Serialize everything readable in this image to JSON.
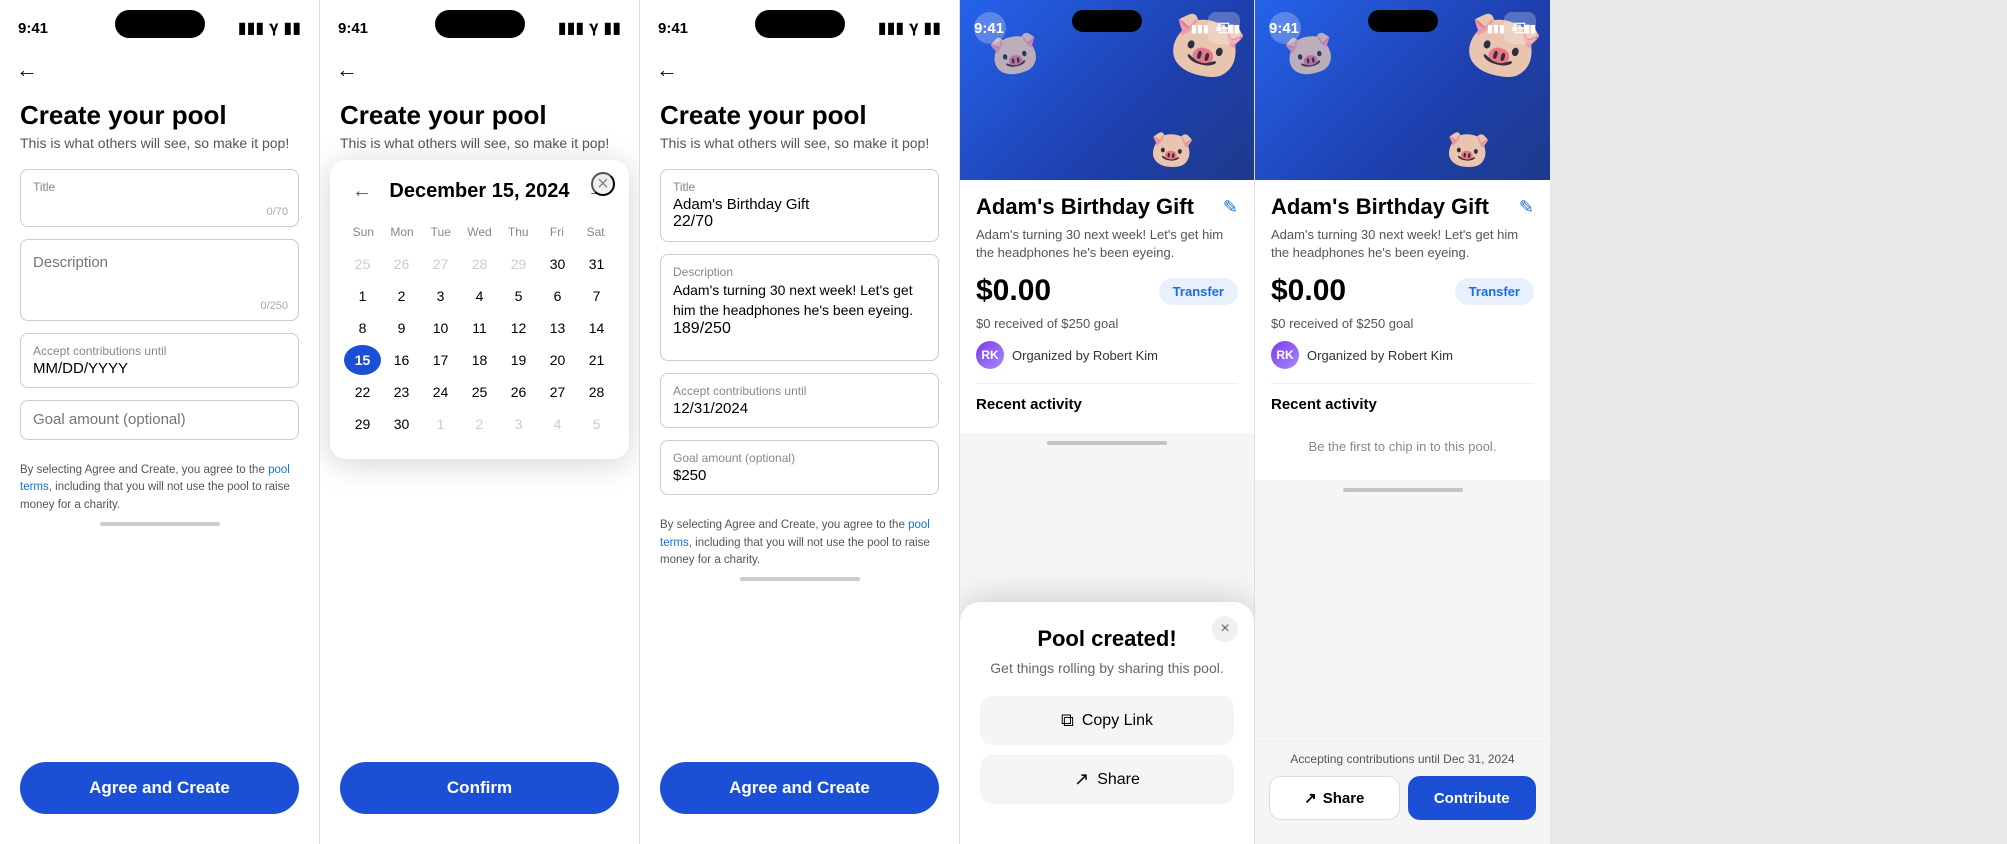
{
  "screens": [
    {
      "id": "screen1",
      "status_time": "9:41",
      "title": "Create your pool",
      "subtitle": "This is what others will see, so make it pop!",
      "fields": {
        "title_label": "Title",
        "title_placeholder": "",
        "title_charcount": "0/70",
        "description_label": "Description",
        "description_placeholder": "Description",
        "description_charcount": "0/250",
        "date_label": "Accept contributions until",
        "date_placeholder": "MM/DD/YYYY",
        "goal_label": "Goal amount (optional)",
        "goal_placeholder": "Goal amount (optional)"
      },
      "terms": "By selecting Agree and Create, you agree to the ",
      "terms_link": "pool terms",
      "terms_end": ", including that you will not use the pool to raise money for a charity.",
      "button_label": "Agree and Create"
    },
    {
      "id": "screen2",
      "status_time": "9:41",
      "title": "Create your pool",
      "subtitle": "This is what others will see, so make it pop!",
      "calendar": {
        "month_year": "December 15, 2024",
        "day_labels": [
          "Sun",
          "Mon",
          "Tue",
          "Wed",
          "Thu",
          "Fri",
          "Sat"
        ],
        "weeks": [
          [
            {
              "day": "25",
              "other": true
            },
            {
              "day": "26",
              "other": true
            },
            {
              "day": "27",
              "other": true
            },
            {
              "day": "28",
              "other": true
            },
            {
              "day": "29",
              "other": true
            },
            {
              "day": "30",
              "other": false
            },
            {
              "day": "31",
              "other": false
            }
          ],
          [
            {
              "day": "1",
              "other": false
            },
            {
              "day": "2",
              "other": false
            },
            {
              "day": "3",
              "other": false
            },
            {
              "day": "4",
              "other": false
            },
            {
              "day": "5",
              "other": false
            },
            {
              "day": "6",
              "other": false
            },
            {
              "day": "7",
              "other": false
            }
          ],
          [
            {
              "day": "8",
              "other": false
            },
            {
              "day": "9",
              "other": false
            },
            {
              "day": "10",
              "other": false
            },
            {
              "day": "11",
              "other": false
            },
            {
              "day": "12",
              "other": false
            },
            {
              "day": "13",
              "other": false
            },
            {
              "day": "14",
              "other": false
            }
          ],
          [
            {
              "day": "15",
              "other": false,
              "selected": true
            },
            {
              "day": "16",
              "other": false
            },
            {
              "day": "17",
              "other": false
            },
            {
              "day": "18",
              "other": false
            },
            {
              "day": "19",
              "other": false
            },
            {
              "day": "20",
              "other": false
            },
            {
              "day": "21",
              "other": false
            }
          ],
          [
            {
              "day": "22",
              "other": false
            },
            {
              "day": "23",
              "other": false
            },
            {
              "day": "24",
              "other": false
            },
            {
              "day": "25",
              "other": false
            },
            {
              "day": "26",
              "other": false
            },
            {
              "day": "27",
              "other": false
            },
            {
              "day": "28",
              "other": false
            }
          ],
          [
            {
              "day": "29",
              "other": false
            },
            {
              "day": "30",
              "other": false
            },
            {
              "day": "1",
              "other": true
            },
            {
              "day": "2",
              "other": true
            },
            {
              "day": "3",
              "other": true
            },
            {
              "day": "4",
              "other": true
            },
            {
              "day": "5",
              "other": true
            }
          ]
        ]
      },
      "button_label": "Confirm"
    },
    {
      "id": "screen3",
      "status_time": "9:41",
      "title": "Create your pool",
      "subtitle": "This is what others will see, so make it pop!",
      "fields": {
        "title_label": "Title",
        "title_value": "Adam's Birthday Gift",
        "title_charcount": "22/70",
        "description_label": "Description",
        "description_value": "Adam's turning 30 next week! Let's get him the headphones he's been eyeing.",
        "description_charcount": "189/250",
        "date_label": "Accept contributions until",
        "date_value": "12/31/2024",
        "goal_label": "Goal amount (optional)",
        "goal_value": "$250"
      },
      "terms": "By selecting Agree and Create, you agree to the ",
      "terms_link": "pool terms",
      "terms_end": ", including that you will not use the pool to raise money for a charity.",
      "button_label": "Agree and Create"
    },
    {
      "id": "screen4",
      "status_time": "9:41",
      "card_title": "Adam's Birthday Gift",
      "card_desc": "Adam's turning 30 next week! Let's get him the headphones he's been eyeing.",
      "amount": "$0.00",
      "transfer_btn": "Transfer",
      "goal_text": "$0 received of $250 goal",
      "organizer": "Organized by Robert Kim",
      "recent_activity": "Recent activity",
      "activity_empty": "Be the first to chip in to this pool.",
      "modal": {
        "title": "Pool created!",
        "subtitle": "Get things rolling by sharing this pool.",
        "copy_link": "Copy Link",
        "share": "Share"
      }
    },
    {
      "id": "screen5",
      "status_time": "9:41",
      "card_title": "Adam's Birthday Gift",
      "card_desc": "Adam's turning 30 next week! Let's get him the headphones he's been eyeing.",
      "amount": "$0.00",
      "transfer_btn": "Transfer",
      "goal_text": "$0 received of $250 goal",
      "organizer": "Organized by Robert Kim",
      "recent_activity": "Recent activity",
      "activity_empty": "Be the first to chip in to this pool.",
      "accepting_text": "Accepting contributions until Dec 31, 2024",
      "share_btn": "Share",
      "contribute_btn": "Contribute"
    }
  ],
  "icons": {
    "back_arrow": "←",
    "close": "×",
    "cal_prev": "←",
    "cal_next": "→",
    "edit": "✎",
    "copy": "⧉",
    "share": "↗",
    "image": "⬜",
    "chevron_left": "‹",
    "chevron_right": "›"
  }
}
